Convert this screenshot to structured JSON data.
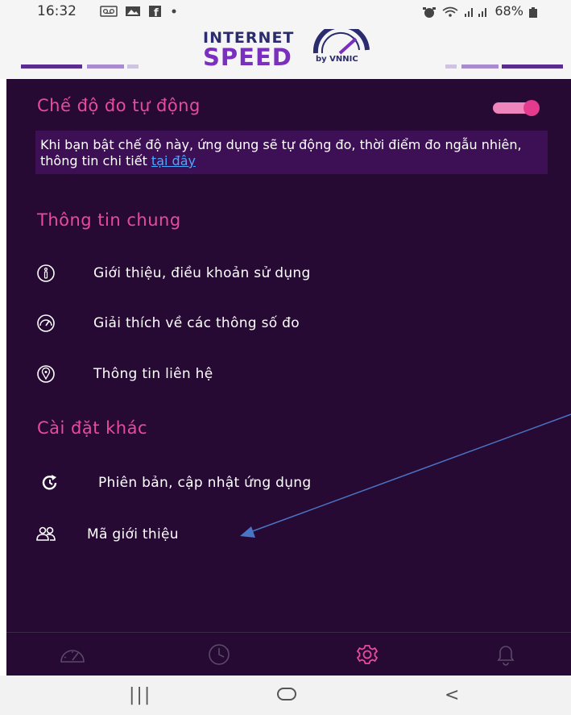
{
  "status_bar": {
    "time": "16:32",
    "notification_icons": [
      "voicemail-icon",
      "gallery-icon",
      "facebook-icon",
      "dot-icon"
    ],
    "right_text": "68%",
    "right_icons": [
      "alarm-icon",
      "wifi-icon",
      "signal-icon",
      "battery-icon"
    ]
  },
  "header": {
    "logo_line1": "INTERNET",
    "logo_line2": "SPEED",
    "logo_by": "by VNNIC"
  },
  "auto_mode": {
    "title": "Chế độ đo tự động",
    "toggle_on": true,
    "notice_text": "Khi bạn bật chế độ này, ứng dụng sẽ tự động đo, thời điểm đo ngẫu nhiên, thông tin chi tiết ",
    "notice_link": "tại đây"
  },
  "general_info": {
    "title": "Thông tin chung",
    "items": [
      {
        "label": "Giới thiệu, điều khoản sử dụng",
        "icon": "info-icon"
      },
      {
        "label": "Giải thích về các thông số đo",
        "icon": "speedometer-icon"
      },
      {
        "label": "Thông tin liên hệ",
        "icon": "location-icon"
      }
    ]
  },
  "other_settings": {
    "title": "Cài đặt khác",
    "items": [
      {
        "label": "Phiên bản, cập nhật ứng dụng",
        "icon": "refresh-icon"
      },
      {
        "label": "Mã giới thiệu",
        "icon": "users-icon"
      }
    ]
  },
  "bottom_nav": {
    "items": [
      {
        "icon": "speed-test-icon",
        "active": false
      },
      {
        "icon": "history-icon",
        "active": false
      },
      {
        "icon": "settings-icon",
        "active": true
      },
      {
        "icon": "notification-bell-icon",
        "active": false
      }
    ]
  },
  "system_nav": {
    "recents": "|||",
    "home": "○",
    "back": "<"
  },
  "colors": {
    "background": "#260a34",
    "accent_pink": "#e94aa0",
    "notice_bg": "#3d0f55",
    "link": "#4aa8ff",
    "active_nav": "#e94aa0"
  }
}
